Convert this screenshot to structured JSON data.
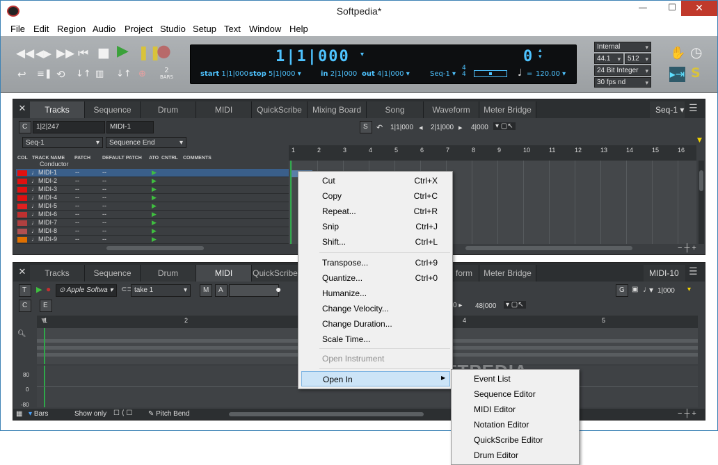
{
  "window": {
    "title": "Softpedia*",
    "min": "—",
    "max": "☐",
    "close": "✕"
  },
  "menu": [
    "File",
    "Edit",
    "Region",
    "Audio",
    "Project",
    "Studio",
    "Setup",
    "Text",
    "Window",
    "Help"
  ],
  "transport": {
    "counter_main": "1|1|000",
    "counter_right": "0",
    "start_label": "start",
    "start_val": "1|1|000",
    "stop_label": "stop",
    "stop_val": "5|1|000",
    "in_label": "in",
    "in_val": "2|1|000",
    "out_label": "out",
    "out_val": "4|1|000",
    "seq": "Seq-1",
    "meter_top": "4",
    "meter_bot": "4",
    "tempo_eq": "=",
    "tempo": "120.00",
    "bars_label": "BARS",
    "bars_num": "2"
  },
  "settings": {
    "clock": "Internal",
    "rate": "44.1 kHz",
    "buffer": "512",
    "format": "24 Bit Integer",
    "fps": "30 fps nd"
  },
  "top_panel": {
    "tabs": [
      "Tracks",
      "Sequence",
      "Drum",
      "MIDI",
      "QuickScribe",
      "Mixing Board",
      "Song",
      "Waveform",
      "Meter Bridge"
    ],
    "active_tab": "Tracks",
    "seq_select": "Seq-1",
    "c_label": "C",
    "position": "1|2|247",
    "track_name": "MIDI-1",
    "seq_dropdown": "Seq-1",
    "end_dropdown": "Sequence End",
    "s_label": "S",
    "loop_start": "1|1|000",
    "loop_mid": "2|1|000",
    "loop_end": "4|000",
    "col_headers": [
      "COL",
      "TRACK NAME",
      "PATCH",
      "DEFAULT PATCH",
      "ATO",
      "CNTRL",
      "COMMENTS"
    ],
    "conductor": "Conductor",
    "tracks": [
      {
        "name": "MIDI-1",
        "patch": "--",
        "default": "--",
        "color": "#e01010"
      },
      {
        "name": "MIDI-2",
        "patch": "--",
        "default": "--",
        "color": "#e01010"
      },
      {
        "name": "MIDI-3",
        "patch": "--",
        "default": "--",
        "color": "#e01010"
      },
      {
        "name": "MIDI-4",
        "patch": "--",
        "default": "--",
        "color": "#e01010"
      },
      {
        "name": "MIDI-5",
        "patch": "--",
        "default": "--",
        "color": "#e02020"
      },
      {
        "name": "MIDI-6",
        "patch": "--",
        "default": "--",
        "color": "#c03030"
      },
      {
        "name": "MIDI-7",
        "patch": "--",
        "default": "--",
        "color": "#b04040"
      },
      {
        "name": "MIDI-8",
        "patch": "--",
        "default": "--",
        "color": "#b05050"
      },
      {
        "name": "MIDI-9",
        "patch": "--",
        "default": "--",
        "color": "#e07000"
      }
    ],
    "ruler_nums": [
      "1",
      "2",
      "3",
      "4",
      "5",
      "6",
      "7",
      "8",
      "9",
      "10",
      "11",
      "12",
      "13",
      "14",
      "15",
      "16"
    ]
  },
  "bottom_panel": {
    "tabs": [
      "Tracks",
      "Sequence",
      "Drum",
      "MIDI",
      "QuickScribe",
      "form",
      "Meter Bridge"
    ],
    "active_tab": "MIDI",
    "seq_select": "MIDI-10",
    "t_label": "T",
    "instrument": "Apple Softwa",
    "take": "take 1",
    "m_label": "M",
    "a_label": "A",
    "g_label": "G",
    "pos_right": "1|000",
    "c_label": "C",
    "e_label": "E",
    "pos_mid": "48|000",
    "ruler_nums": [
      "1",
      "2",
      "4",
      "5"
    ],
    "vel_labels": [
      "80",
      "0",
      "-80"
    ],
    "bars_label": "Bars",
    "show_only": "Show only",
    "pitch_bend": "Pitch Bend"
  },
  "context_menu": [
    {
      "label": "Cut",
      "shortcut": "Ctrl+X"
    },
    {
      "label": "Copy",
      "shortcut": "Ctrl+C"
    },
    {
      "label": "Repeat...",
      "shortcut": "Ctrl+R"
    },
    {
      "label": "Snip",
      "shortcut": "Ctrl+J"
    },
    {
      "label": "Shift...",
      "shortcut": "Ctrl+L"
    },
    {
      "label": "Transpose...",
      "shortcut": "Ctrl+9"
    },
    {
      "label": "Quantize...",
      "shortcut": "Ctrl+0"
    },
    {
      "label": "Humanize...",
      "shortcut": ""
    },
    {
      "label": "Change Velocity...",
      "shortcut": ""
    },
    {
      "label": "Change Duration...",
      "shortcut": ""
    },
    {
      "label": "Scale Time...",
      "shortcut": ""
    },
    {
      "label": "Open Instrument",
      "shortcut": ""
    },
    {
      "label": "Open In",
      "shortcut": ""
    }
  ],
  "submenu": [
    "Event List",
    "Sequence Editor",
    "MIDI Editor",
    "Notation Editor",
    "QuickScribe Editor",
    "Drum Editor"
  ],
  "watermark": "SOFTPEDIA"
}
